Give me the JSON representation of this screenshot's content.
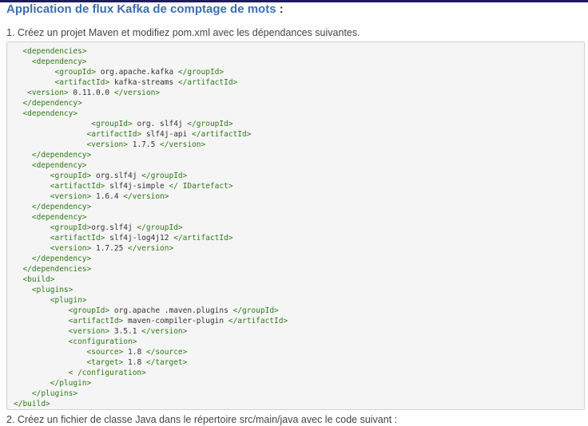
{
  "heading": {
    "title": "Application de flux Kafka de comptage de mots",
    "suffix": " :"
  },
  "steps": {
    "step1": "1. Créez un projet Maven et modifiez pom.xml avec les dépendances suivantes.",
    "step2": "2. Créez un fichier de classe Java dans le répertoire src/main/java avec le code suivant :"
  },
  "code": {
    "lines": [
      [
        {
          "i": 2
        },
        {
          "t": "<dependencies>"
        }
      ],
      [
        {
          "i": 4
        },
        {
          "t": "<dependency>"
        }
      ],
      [
        {
          "i": 9
        },
        {
          "t": "<groupId>"
        },
        {
          "v": " org.apache.kafka "
        },
        {
          "t": "</groupId>"
        }
      ],
      [
        {
          "i": 9
        },
        {
          "t": "<artifactId>"
        },
        {
          "v": " kafka-streams "
        },
        {
          "t": "</artifactId>"
        }
      ],
      [
        {
          "i": 3
        },
        {
          "t": "<version>"
        },
        {
          "v": " 0.11.0.0 "
        },
        {
          "t": "</version>"
        }
      ],
      [
        {
          "i": 2
        },
        {
          "t": "</dependency>"
        }
      ],
      [
        {
          "i": 2
        },
        {
          "t": "<dependency>"
        }
      ],
      [
        {
          "i": 17
        },
        {
          "t": "<groupId>"
        },
        {
          "v": " org. slf4j "
        },
        {
          "t": "</groupId>"
        }
      ],
      [
        {
          "i": 16
        },
        {
          "t": "<artifactId>"
        },
        {
          "v": " slf4j-api "
        },
        {
          "t": "</artifactId>"
        }
      ],
      [
        {
          "i": 16
        },
        {
          "t": "<version>"
        },
        {
          "v": " 1.7.5 "
        },
        {
          "t": "</version>"
        }
      ],
      [
        {
          "i": 4
        },
        {
          "t": "</dependency>"
        }
      ],
      [
        {
          "i": 4
        },
        {
          "t": "<dependency>"
        }
      ],
      [
        {
          "i": 8
        },
        {
          "t": "<groupId>"
        },
        {
          "v": " org.slf4j "
        },
        {
          "t": "</groupId>"
        }
      ],
      [
        {
          "i": 8
        },
        {
          "t": "<artifactId>"
        },
        {
          "v": " slf4j-simple "
        },
        {
          "t": "</ IDartefact>"
        }
      ],
      [
        {
          "i": 8
        },
        {
          "t": "<version>"
        },
        {
          "v": " 1.6.4 "
        },
        {
          "t": "</version>"
        }
      ],
      [
        {
          "i": 4
        },
        {
          "t": "</dependency>"
        }
      ],
      [
        {
          "i": 4
        },
        {
          "t": "<dependency>"
        }
      ],
      [
        {
          "i": 8
        },
        {
          "t": "<groupId>"
        },
        {
          "v": "org.slf4j "
        },
        {
          "t": "</groupId>"
        }
      ],
      [
        {
          "i": 8
        },
        {
          "t": "<artifactId>"
        },
        {
          "v": " slf4j-log4j12 "
        },
        {
          "t": "</artifactId>"
        }
      ],
      [
        {
          "i": 8
        },
        {
          "t": "<version>"
        },
        {
          "v": " 1.7.25 "
        },
        {
          "t": "</version>"
        }
      ],
      [
        {
          "i": 4
        },
        {
          "t": "</dependency>"
        }
      ],
      [
        {
          "i": 2
        },
        {
          "t": "</dependencies>"
        }
      ],
      [
        {
          "i": 2
        },
        {
          "t": "<build>"
        }
      ],
      [
        {
          "i": 4
        },
        {
          "t": "<plugins>"
        }
      ],
      [
        {
          "i": 8
        },
        {
          "t": "<plugin>"
        }
      ],
      [
        {
          "i": 12
        },
        {
          "t": "<groupId>"
        },
        {
          "v": " org.apache .maven.plugins "
        },
        {
          "t": "</groupId>"
        }
      ],
      [
        {
          "i": 12
        },
        {
          "t": "<artifactId>"
        },
        {
          "v": " maven-compiler-plugin "
        },
        {
          "t": "</artifactId>"
        }
      ],
      [
        {
          "i": 12
        },
        {
          "t": "<version>"
        },
        {
          "v": " 3.5.1 "
        },
        {
          "t": "</version>"
        }
      ],
      [
        {
          "i": 12
        },
        {
          "t": "<configuration>"
        }
      ],
      [
        {
          "i": 16
        },
        {
          "t": "<source>"
        },
        {
          "v": " 1.8 "
        },
        {
          "t": "</source>"
        }
      ],
      [
        {
          "i": 16
        },
        {
          "t": "<target>"
        },
        {
          "v": " 1.8 "
        },
        {
          "t": "</target>"
        }
      ],
      [
        {
          "i": 12
        },
        {
          "t": "< /configuration>"
        }
      ],
      [
        {
          "i": 8
        },
        {
          "t": "</plugin>"
        }
      ],
      [
        {
          "i": 4
        },
        {
          "t": "</plugins>"
        }
      ],
      [
        {
          "i": 0
        },
        {
          "t": "</build>"
        }
      ]
    ]
  },
  "colors": {
    "heading": "#3b6fb3",
    "tag": "#2f7a18",
    "code_background": "#f5f5f5",
    "top_bar": "#1f1b5c"
  }
}
